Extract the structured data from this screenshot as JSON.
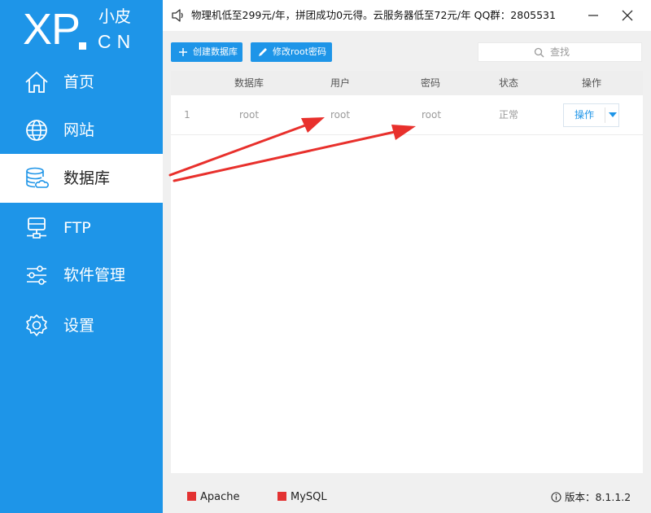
{
  "app": {
    "logo_main": "XP",
    "logo_small": "小皮",
    "logo_domain": "CN"
  },
  "sidebar": {
    "items": [
      {
        "label": "首页",
        "icon": "home-icon",
        "active": false
      },
      {
        "label": "网站",
        "icon": "globe-icon",
        "active": false
      },
      {
        "label": "数据库",
        "icon": "database-icon",
        "active": true
      },
      {
        "label": "FTP",
        "icon": "ftp-server-icon",
        "active": false
      },
      {
        "label": "软件管理",
        "icon": "sliders-icon",
        "active": false
      },
      {
        "label": "设置",
        "icon": "gear-icon",
        "active": false
      }
    ]
  },
  "topbar": {
    "notice": "物理机低至299元/年，拼团成功0元得。云服务器低至72元/年 QQ群：2805531"
  },
  "toolbar": {
    "create_label": "创建数据库",
    "change_pwd_label": "修改root密码",
    "search_placeholder": "查找"
  },
  "table": {
    "headers": [
      "数据库",
      "用户",
      "密码",
      "状态",
      "操作"
    ],
    "rows": [
      {
        "index": "1",
        "database": "root",
        "user": "root",
        "password": "root",
        "status": "正常",
        "action": "操作"
      }
    ]
  },
  "footer": {
    "services": [
      {
        "name": "Apache",
        "status_color": "#e33232"
      },
      {
        "name": "MySQL",
        "status_color": "#e33232"
      }
    ],
    "version": "版本：8.1.1.2"
  },
  "colors": {
    "accent": "#1e95e8",
    "arrow": "#e8302c",
    "stopped": "#e33232"
  }
}
